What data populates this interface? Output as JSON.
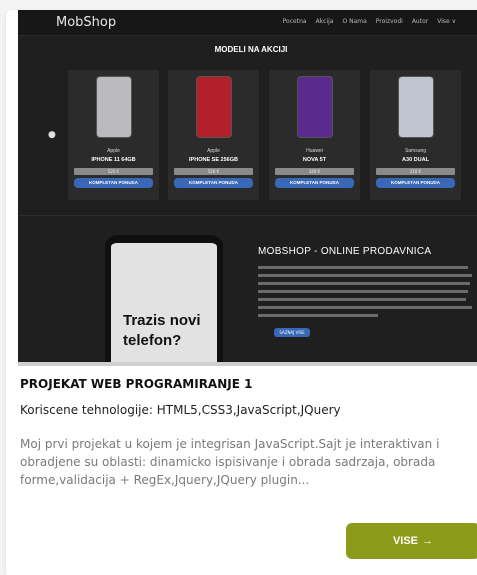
{
  "preview": {
    "logo": "MobShop",
    "nav_items": [
      "Pocetna",
      "Akcija",
      "O Nama",
      "Proizvodi",
      "Autor",
      "Vise ∨"
    ],
    "section_title": "MODELI NA AKCIJI",
    "products": [
      {
        "brand": "Apple",
        "model": "IPHONE 11 64GB",
        "price": "520 €",
        "offer": "KOMPLETAN PONUDA",
        "color": "#b9b9be"
      },
      {
        "brand": "Apple",
        "model": "IPHONE SE 256GB",
        "price": "520 €",
        "offer": "KOMPLETAN PONUDA",
        "color": "#b3202a"
      },
      {
        "brand": "Huawei",
        "model": "NOVA 5T",
        "price": "320 €",
        "offer": "KOMPLETAN PONUDA",
        "color": "#5a2a8c"
      },
      {
        "brand": "Samsung",
        "model": "A30 DUAL",
        "price": "210 €",
        "offer": "KOMPLETAN PONUDA",
        "color": "#bfc6cf"
      }
    ],
    "hero_text": "Trazis novi telefon?",
    "about_title": "MOBSHOP - ONLINE PRODAVNICA",
    "about_button": "SAZNAJ VISE"
  },
  "project": {
    "title": "PROJEKAT WEB PROGRAMIRANJE 1",
    "tech": "Koriscene tehnologije: HTML5,CSS3,JavaScript,JQuery",
    "description": "Moj prvi projekat u kojem je integrisan JavaScript.Sajt je interaktivan i obradjene su oblasti: dinamicko ispisivanje i obrada sadrzaja, obrada forme,validacija + RegEx,Jquery,JQuery plugin...",
    "more_label": "VISE",
    "more_icon": "arrow-right-icon"
  },
  "colors": {
    "button": "#8c9c1a",
    "preview_bg": "#1f1f1f",
    "offer_button": "#3a68b8"
  }
}
